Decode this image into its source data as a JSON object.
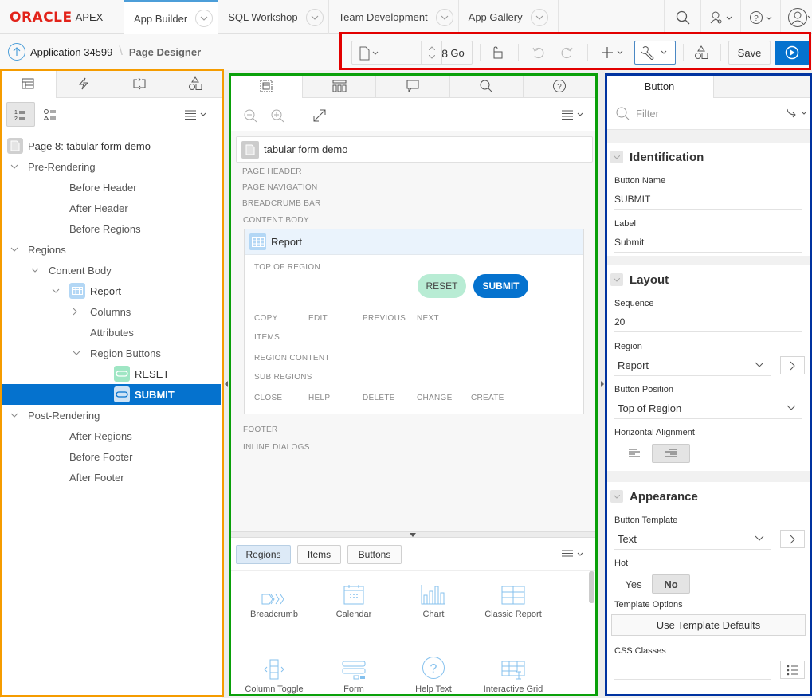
{
  "topnav": {
    "logo_brand": "ORACLE",
    "logo_product": "APEX",
    "tabs": [
      {
        "label": "App Builder",
        "active": true
      },
      {
        "label": "SQL Workshop",
        "active": false
      },
      {
        "label": "Team Development",
        "active": false
      },
      {
        "label": "App Gallery",
        "active": false
      }
    ],
    "right_icons": [
      "search-icon",
      "administration-icon",
      "help-icon",
      "user-icon"
    ]
  },
  "breadcrumb": {
    "parent": "Application 34599",
    "current": "Page Designer"
  },
  "toolbar": {
    "page_number": "8",
    "go_label": "Go",
    "save_label": "Save"
  },
  "left_panel": {
    "tabs": [
      "rendering-tab",
      "dynamic-actions-tab",
      "processing-tab",
      "shared-components-tab"
    ],
    "tree": [
      {
        "label": "Page 8: tabular form demo",
        "level": 0,
        "icon": "page-icon"
      },
      {
        "label": "Pre-Rendering",
        "level": 0,
        "caret": "down"
      },
      {
        "label": "Before Header",
        "level": 2
      },
      {
        "label": "After Header",
        "level": 2
      },
      {
        "label": "Before Regions",
        "level": 2
      },
      {
        "label": "Regions",
        "level": 0,
        "caret": "down"
      },
      {
        "label": "Content Body",
        "level": 1,
        "caret": "down"
      },
      {
        "label": "Report",
        "level": 2,
        "caret": "down",
        "icon": "report-icon"
      },
      {
        "label": "Columns",
        "level": 3,
        "caret": "right"
      },
      {
        "label": "Attributes",
        "level": 3
      },
      {
        "label": "Region Buttons",
        "level": 3,
        "caret": "down"
      },
      {
        "label": "RESET",
        "level": 5,
        "icon": "button-icon"
      },
      {
        "label": "SUBMIT",
        "level": 5,
        "icon": "button-icon",
        "selected": true
      },
      {
        "label": "Post-Rendering",
        "level": 0,
        "caret": "down"
      },
      {
        "label": "After Regions",
        "level": 2
      },
      {
        "label": "Before Footer",
        "level": 2
      },
      {
        "label": "After Footer",
        "level": 2
      }
    ]
  },
  "center_panel": {
    "page_title": "tabular form demo",
    "positions_top": [
      "PAGE HEADER",
      "PAGE NAVIGATION",
      "BREADCRUMB BAR",
      "CONTENT BODY"
    ],
    "region": {
      "title": "Report",
      "top_of_region": "TOP OF REGION",
      "reset_label": "RESET",
      "submit_label": "SUBMIT",
      "row1": [
        "COPY",
        "EDIT",
        "PREVIOUS",
        "NEXT"
      ],
      "items": "ITEMS",
      "region_content": "REGION CONTENT",
      "sub_regions": "SUB REGIONS",
      "row2": [
        "CLOSE",
        "HELP",
        "DELETE",
        "CHANGE",
        "CREATE"
      ]
    },
    "positions_bottom": [
      "FOOTER",
      "INLINE DIALOGS"
    ],
    "gallery": {
      "tabs": [
        {
          "label": "Regions",
          "active": true
        },
        {
          "label": "Items",
          "active": false
        },
        {
          "label": "Buttons",
          "active": false
        }
      ],
      "items": [
        "Breadcrumb",
        "Calendar",
        "Chart",
        "Classic Report",
        "Column Toggle",
        "Form",
        "Help Text",
        "Interactive Grid"
      ]
    }
  },
  "right_panel": {
    "tab": "Button",
    "filter_placeholder": "Filter",
    "sections": {
      "identification": {
        "title": "Identification",
        "button_name_label": "Button Name",
        "button_name": "SUBMIT",
        "label_label": "Label",
        "label": "Submit"
      },
      "layout": {
        "title": "Layout",
        "sequence_label": "Sequence",
        "sequence": "20",
        "region_label": "Region",
        "region": "Report",
        "position_label": "Button Position",
        "position": "Top of Region",
        "alignment_label": "Horizontal Alignment",
        "alignment": "right"
      },
      "appearance": {
        "title": "Appearance",
        "template_label": "Button Template",
        "template": "Text",
        "hot_label": "Hot",
        "hot_yes": "Yes",
        "hot_no": "No",
        "hot_value": "No",
        "template_options_label": "Template Options",
        "template_options_button": "Use Template Defaults",
        "css_classes_label": "CSS Classes",
        "css_classes": ""
      }
    }
  },
  "colors": {
    "accent": "#0572ce",
    "reset_button": "#b8ecd4",
    "annotation_orange": "#f59c00",
    "annotation_green": "#0aa00a",
    "annotation_blue": "#0033a0",
    "annotation_red": "#e20000"
  }
}
